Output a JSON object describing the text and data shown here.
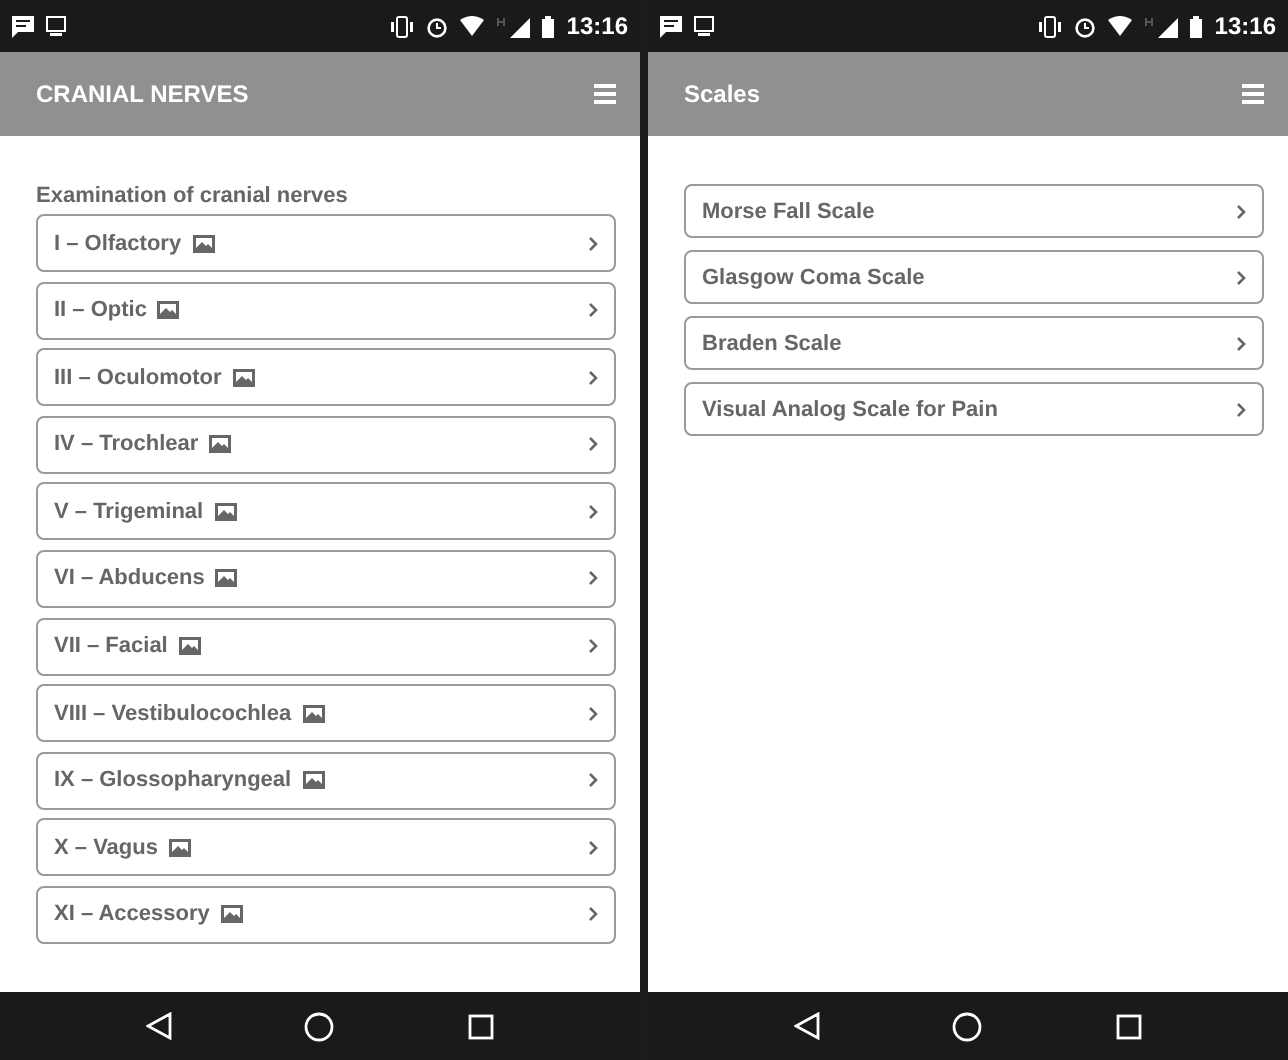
{
  "screens": [
    {
      "status_time": "13:16",
      "title": "CRANIAL NERVES",
      "section_heading": "Examination of cranial nerves",
      "items": [
        {
          "label": "I – Olfactory",
          "image_icon": true
        },
        {
          "label": "II – Optic",
          "image_icon": true
        },
        {
          "label": "III – Oculomotor",
          "image_icon": true
        },
        {
          "label": "IV – Trochlear",
          "image_icon": true
        },
        {
          "label": "V – Trigeminal",
          "image_icon": true
        },
        {
          "label": "VI – Abducens",
          "image_icon": true
        },
        {
          "label": "VII – Facial",
          "image_icon": true
        },
        {
          "label": "VIII – Vestibulocochlea",
          "image_icon": true
        },
        {
          "label": "IX – Glossopharyngeal",
          "image_icon": true
        },
        {
          "label": "X – Vagus",
          "image_icon": true
        },
        {
          "label": "XI – Accessory",
          "image_icon": true
        }
      ]
    },
    {
      "status_time": "13:16",
      "title": "Scales",
      "items": [
        {
          "label": "Morse Fall Scale",
          "image_icon": false
        },
        {
          "label": "Glasgow Coma Scale",
          "image_icon": false
        },
        {
          "label": "Braden Scale",
          "image_icon": false
        },
        {
          "label": "Visual Analog Scale for Pain",
          "image_icon": false
        }
      ]
    }
  ]
}
